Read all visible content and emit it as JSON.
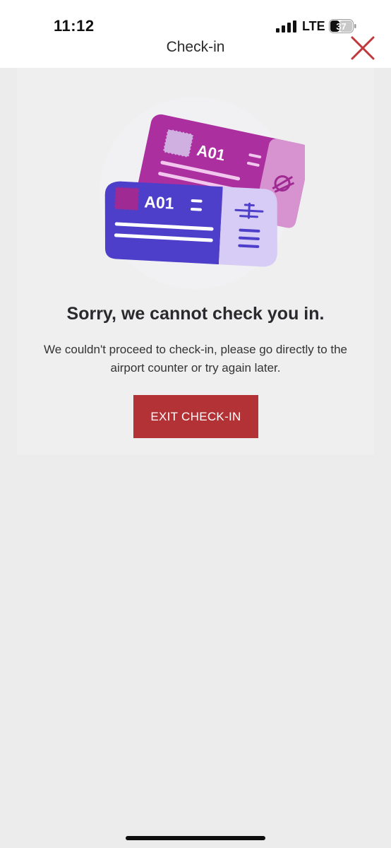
{
  "status_bar": {
    "time": "11:12",
    "network": "LTE",
    "battery": "37"
  },
  "header": {
    "title": "Check-in",
    "close_icon": "close-icon",
    "close_color": "#c0393c"
  },
  "illustration": {
    "ticket_front_label": "A01",
    "ticket_back_label": "A01",
    "icon": "boarding-pass-illustration"
  },
  "error": {
    "title": "Sorry, we cannot check you in.",
    "message": "We couldn't proceed to check-in, please go directly to the airport counter or try again later."
  },
  "actions": {
    "exit_label": "EXIT CHECK-IN",
    "exit_color": "#b23236"
  }
}
